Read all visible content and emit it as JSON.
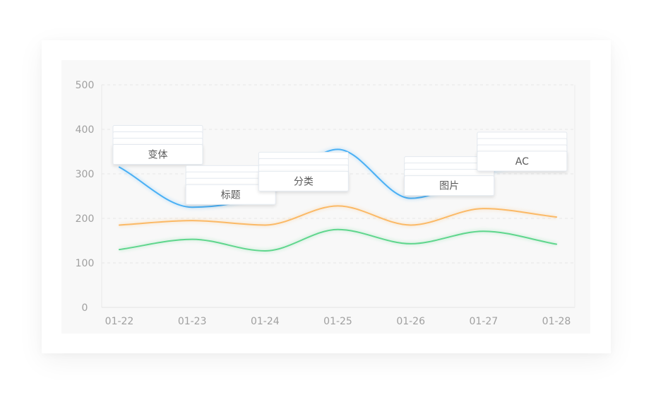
{
  "chart_data": {
    "type": "line",
    "title": "",
    "xlabel": "",
    "ylabel": "",
    "categories": [
      "01-22",
      "01-23",
      "01-24",
      "01-25",
      "01-26",
      "01-27",
      "01-28"
    ],
    "ylim": [
      0,
      500
    ],
    "yticks": [
      0,
      100,
      200,
      300,
      400,
      500
    ],
    "grid": true,
    "series": [
      {
        "color": "#4ab0f5",
        "values": [
          315,
          225,
          255,
          355,
          245,
          300,
          340
        ]
      },
      {
        "color": "#fbb966",
        "values": [
          185,
          195,
          185,
          228,
          185,
          222,
          203
        ]
      },
      {
        "color": "#5fd68d",
        "values": [
          130,
          153,
          127,
          175,
          143,
          171,
          142
        ]
      }
    ],
    "tooltips": [
      {
        "category": "01-22",
        "label": "变体"
      },
      {
        "category": "01-23",
        "label": "标题"
      },
      {
        "category": "01-24",
        "label": "分类"
      },
      {
        "category": "01-26",
        "label": "图片"
      },
      {
        "category": "01-27",
        "label": "AC"
      }
    ]
  }
}
